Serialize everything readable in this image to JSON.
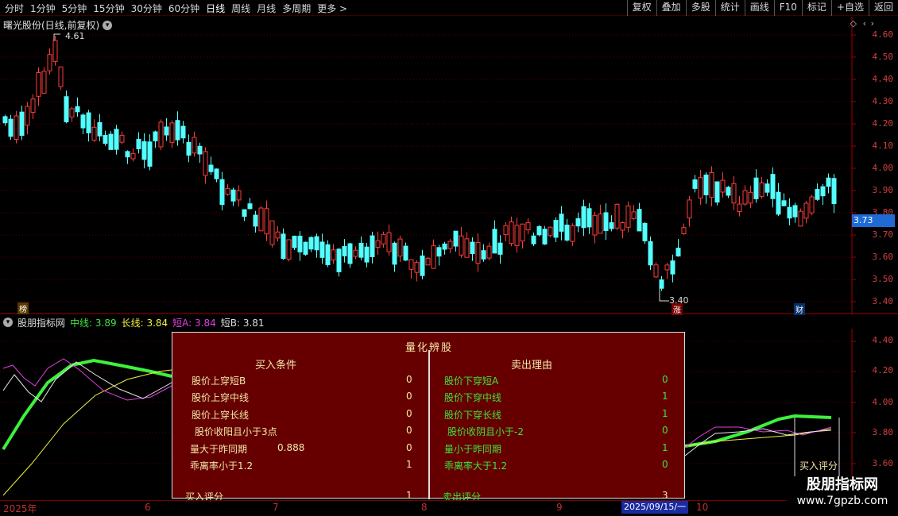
{
  "toolbar": {
    "periods": [
      "分时",
      "1分钟",
      "5分钟",
      "15分钟",
      "30分钟",
      "60分钟",
      "日线",
      "周线",
      "月线",
      "多周期",
      "更多 >"
    ],
    "active_period": "日线",
    "right_buttons": [
      "复权",
      "叠加",
      "多股",
      "统计",
      "画线",
      "F10",
      "标记",
      "+自选",
      "返回"
    ]
  },
  "main": {
    "title": "曙光股份(日线,前复权)",
    "title_icon": "chevron-down-icon",
    "price_axis": [
      "4.60",
      "4.50",
      "4.40",
      "4.30",
      "4.20",
      "4.10",
      "4.00",
      "3.90",
      "3.80",
      "3.70",
      "3.60",
      "3.50",
      "3.40"
    ],
    "current_price": "3.73",
    "high_label": "4.61",
    "low_label": "3.40",
    "tags": {
      "bang": "榜",
      "zhang": "涨",
      "cai": "财"
    },
    "colors": {
      "up": "#ff3b3b",
      "down": "#54ffff",
      "grid": "#5a0000"
    }
  },
  "indicator": {
    "name": "股朋指标网",
    "mid": "中线: 3.89",
    "long": "长线: 3.84",
    "shortA": "短A: 3.84",
    "shortB": "短B: 3.81",
    "axis": [
      "4.40",
      "4.20",
      "4.00",
      "3.80",
      "3.60"
    ]
  },
  "panel": {
    "title": "量化辨股",
    "buy_header": "买入条件",
    "sell_header": "卖出理由",
    "buy_rows": [
      {
        "label": "股价上穿短B",
        "value": "0"
      },
      {
        "label": "股价上穿中线",
        "value": "0"
      },
      {
        "label": "股价上穿长线",
        "value": "0"
      },
      {
        "label": "股价收阳且小于3点",
        "value": "0"
      },
      {
        "label": "量大于昨同期",
        "extra": "0.888",
        "value": "0"
      },
      {
        "label": "乖离率小于1.2",
        "value": "1"
      }
    ],
    "sell_rows": [
      {
        "label": "股价下穿短A",
        "value": "0"
      },
      {
        "label": "股价下穿中线",
        "value": "1"
      },
      {
        "label": "股价下穿长线",
        "value": "1"
      },
      {
        "label": "股价收阴且小于-2",
        "value": "0"
      },
      {
        "label": "量小于昨同期",
        "value": "1"
      },
      {
        "label": "乖离率大于1.2",
        "value": "0"
      }
    ],
    "buy_score_label": "买入评分",
    "buy_score": "1",
    "sell_score_label": "卖出评分",
    "sell_score": "3"
  },
  "score_label": "买入评分",
  "date_axis": {
    "labels": [
      "2025年",
      "6",
      "7",
      "8",
      "9",
      "10"
    ],
    "cursor_date": "2025/09/15/一"
  },
  "watermark": {
    "line1": "股朋指标网",
    "line2": "www.7gpzb.com"
  }
}
